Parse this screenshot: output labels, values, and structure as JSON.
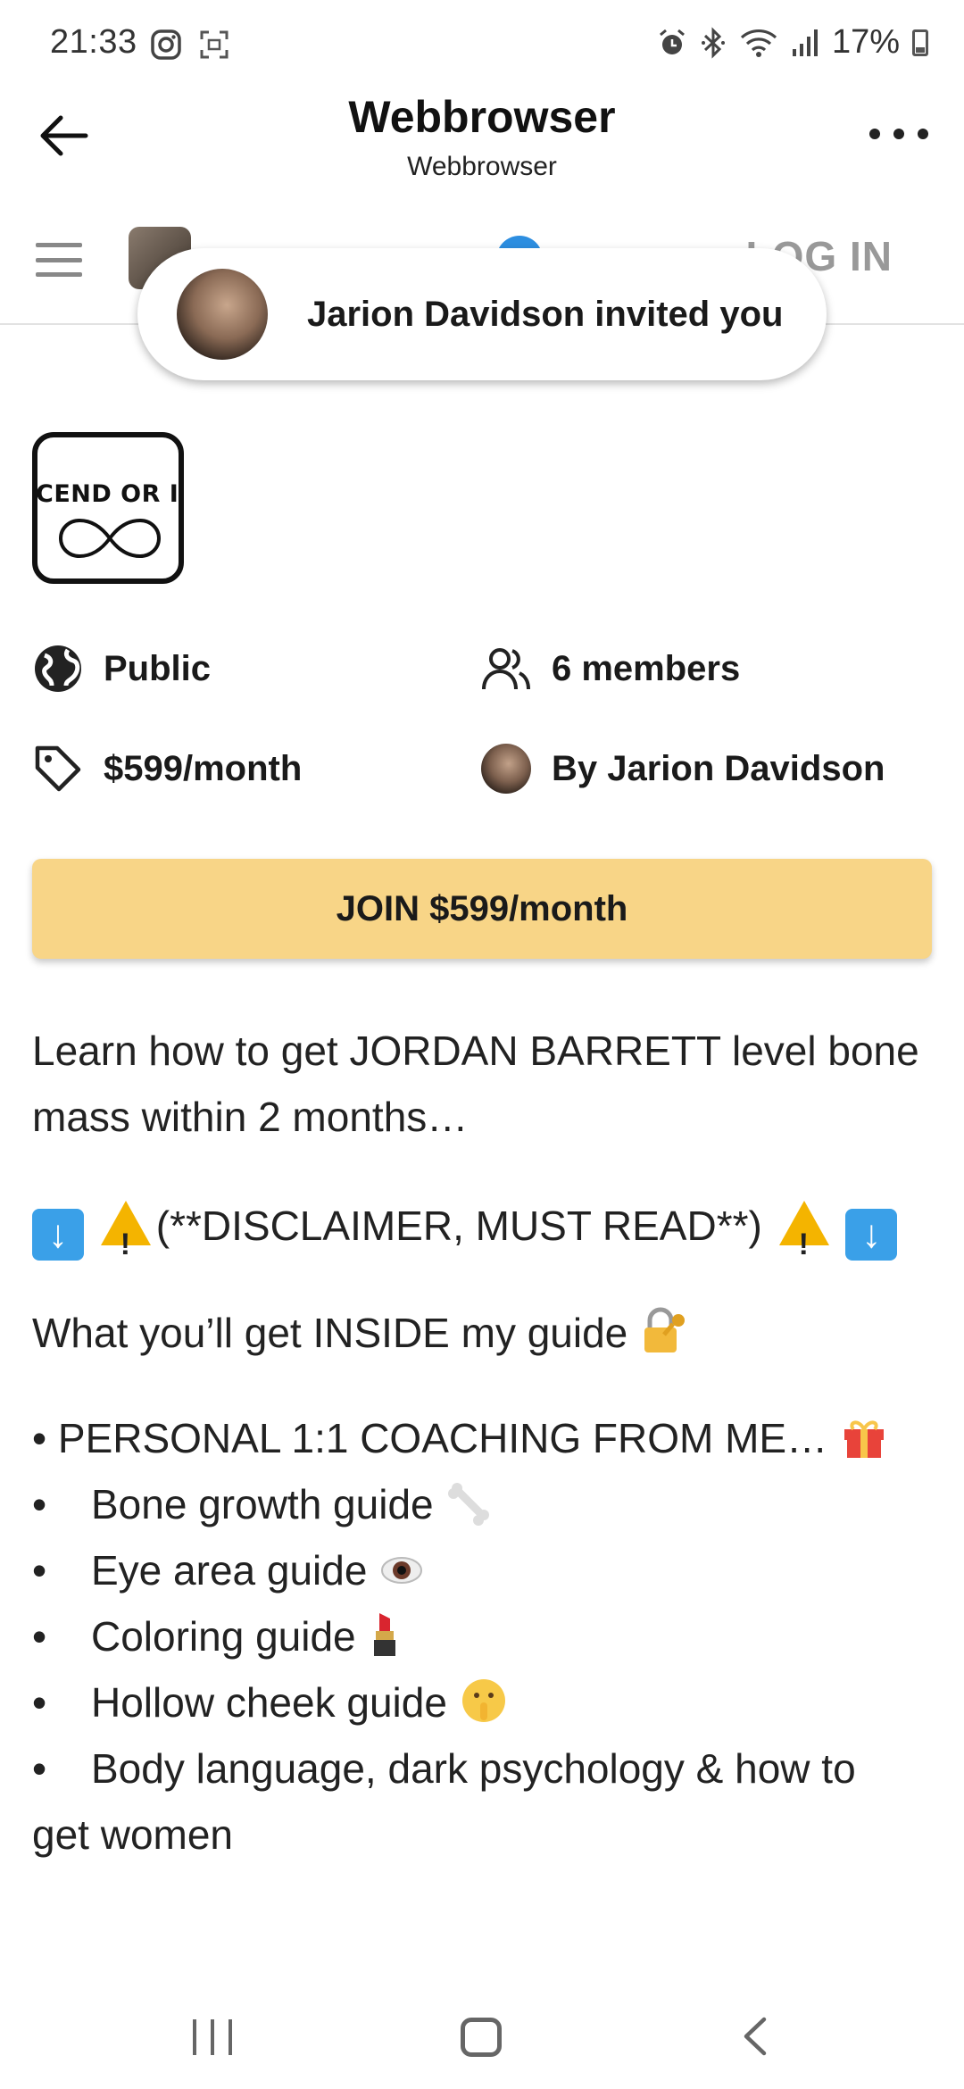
{
  "status_bar": {
    "time": "21:33",
    "battery": "17%",
    "icons": [
      "instagram-icon",
      "screenshot-icon",
      "alarm-icon",
      "bluetooth-icon",
      "wifi-icon",
      "signal-icon",
      "battery-icon"
    ]
  },
  "browser": {
    "title": "Webbrowser",
    "subtitle": "Webbrowser"
  },
  "site_nav": {
    "login_label": "LOG IN"
  },
  "invite": {
    "text": "Jarion Davidson invited you"
  },
  "community": {
    "logo_text": "CEND OR I",
    "privacy": "Public",
    "members": "6 members",
    "price": "$599/month",
    "author": "By Jarion Davidson"
  },
  "join_button": {
    "label": "JOIN $599/month"
  },
  "description": {
    "intro": "Learn how to get JORDAN BARRETT level bone mass within 2 months…",
    "disclaimer": "(**DISCLAIMER, MUST READ**)",
    "inside": "What you’ll get INSIDE my guide",
    "coaching": "• PERSONAL 1:1 COACHING FROM ME…",
    "items": [
      "Bone growth guide",
      "Eye area guide",
      "Coloring guide",
      "Hollow cheek guide",
      "Body language, dark psychology & how to"
    ],
    "last_line": "get women"
  },
  "colors": {
    "join_bg": "#f8d587",
    "arrow_blue": "#3aa0e8",
    "warning": "#f4b400"
  }
}
